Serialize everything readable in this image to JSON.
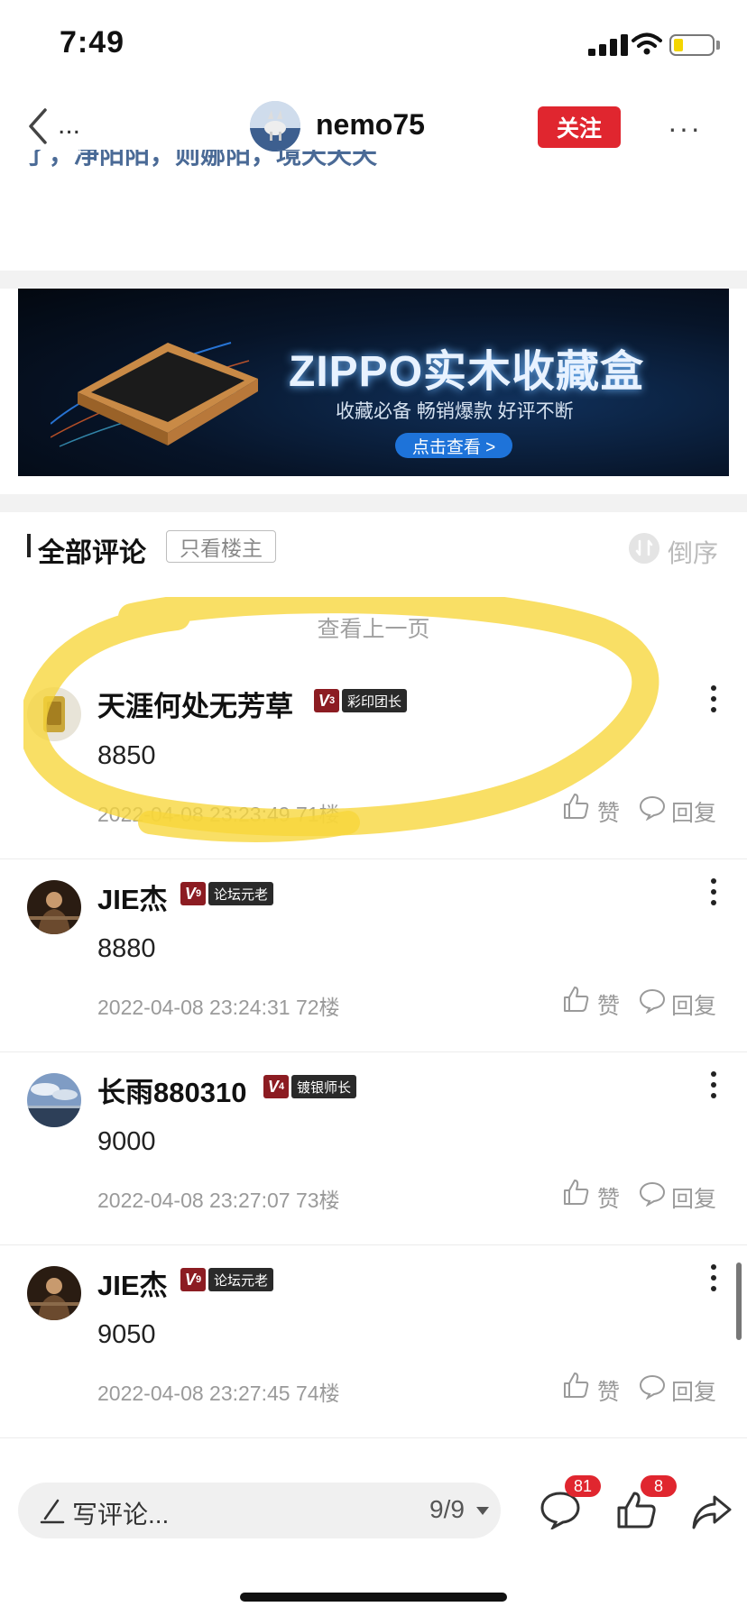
{
  "status_bar": {
    "time": "7:49"
  },
  "nav": {
    "back_dots": "...",
    "title": "nemo75",
    "follow_label": "关注",
    "more_label": "···"
  },
  "post_snippet": {
    "text": "了，净阳阳，则娜阳，境天天天"
  },
  "banner": {
    "title": "ZIPPO实木收藏盒",
    "subtitle": "收藏必备 畅销爆款 好评不断",
    "button": "点击查看 >"
  },
  "comments_header": {
    "title": "全部评论",
    "only_op": "只看楼主",
    "sort_label": "倒序",
    "prev_page": "查看上一页"
  },
  "comments": [
    {
      "user": "天涯何处无芳草",
      "level": "V",
      "level_num": "3",
      "title": "彩印团长",
      "text": "8850",
      "time": "2022-04-08 23:23:49",
      "floor": "71楼",
      "like_label": "赞",
      "reply_label": "回复",
      "avatar": "gold-lighter"
    },
    {
      "user": "JIE杰",
      "level": "V",
      "level_num": "9",
      "title": "论坛元老",
      "text": "8880",
      "time": "2022-04-08 23:24:31",
      "floor": "72楼",
      "like_label": "赞",
      "reply_label": "回复",
      "avatar": "person-dark"
    },
    {
      "user": "长雨880310",
      "level": "V",
      "level_num": "4",
      "title": "镀银师长",
      "text": "9000",
      "time": "2022-04-08 23:27:07",
      "floor": "73楼",
      "like_label": "赞",
      "reply_label": "回复",
      "avatar": "sky-landscape"
    },
    {
      "user": "JIE杰",
      "level": "V",
      "level_num": "9",
      "title": "论坛元老",
      "text": "9050",
      "time": "2022-04-08 23:27:45",
      "floor": "74楼",
      "like_label": "赞",
      "reply_label": "回复",
      "avatar": "person-dark"
    }
  ],
  "bottom_bar": {
    "input_placeholder": "写评论...",
    "page_indicator": "9/9",
    "comment_count": "81",
    "like_count": "8"
  },
  "colors": {
    "accent_red": "#e0262f",
    "highlight_yellow": "#f7d63a",
    "level_badge": "#8c1c22",
    "title_badge": "#2a2a2a",
    "link_blue": "#4a6a96"
  }
}
